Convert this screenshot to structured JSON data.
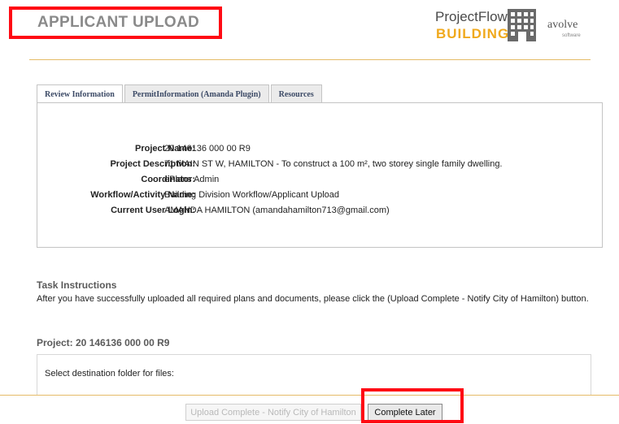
{
  "header": {
    "page_title": "APPLICANT UPLOAD",
    "brand_line1": "ProjectFlow",
    "brand_line2": "BUILDING",
    "vendor": "avolve",
    "vendor_sub": "software"
  },
  "tabs": [
    {
      "label": "Review Information",
      "active": true
    },
    {
      "label": "PermitInformation (Amanda Plugin)",
      "active": false
    },
    {
      "label": "Resources",
      "active": false
    }
  ],
  "review": {
    "rows": [
      {
        "label": "Project Name:",
        "value": "20 146136 000 00 R9"
      },
      {
        "label": "Project Description:",
        "value": "71 MAIN ST W, HAMILTON - To construct a 100 m², two storey single family dwelling."
      },
      {
        "label": "Coordinator:",
        "value": "ePlans Admin"
      },
      {
        "label": "Workflow/Activity Name:",
        "value": "Building Division Workflow/Applicant Upload"
      },
      {
        "label": "Current User Login:",
        "value": "AMANDA HAMILTON (amandahamilton713@gmail.com)"
      }
    ]
  },
  "task": {
    "title": "Task Instructions",
    "text": "After you have successfully uploaded all required plans and documents, please click the (Upload Complete - Notify City of Hamilton) button."
  },
  "project": {
    "title": "Project: 20 146136 000 00 R9",
    "folder_label": "Select destination folder for files:"
  },
  "actions": {
    "upload_complete": "Upload Complete - Notify City of Hamilton",
    "complete_later": "Complete Later"
  },
  "colors": {
    "highlight": "#ff0a14",
    "accent_rule": "#e5bb67",
    "brand_orange": "#f0a91d"
  }
}
